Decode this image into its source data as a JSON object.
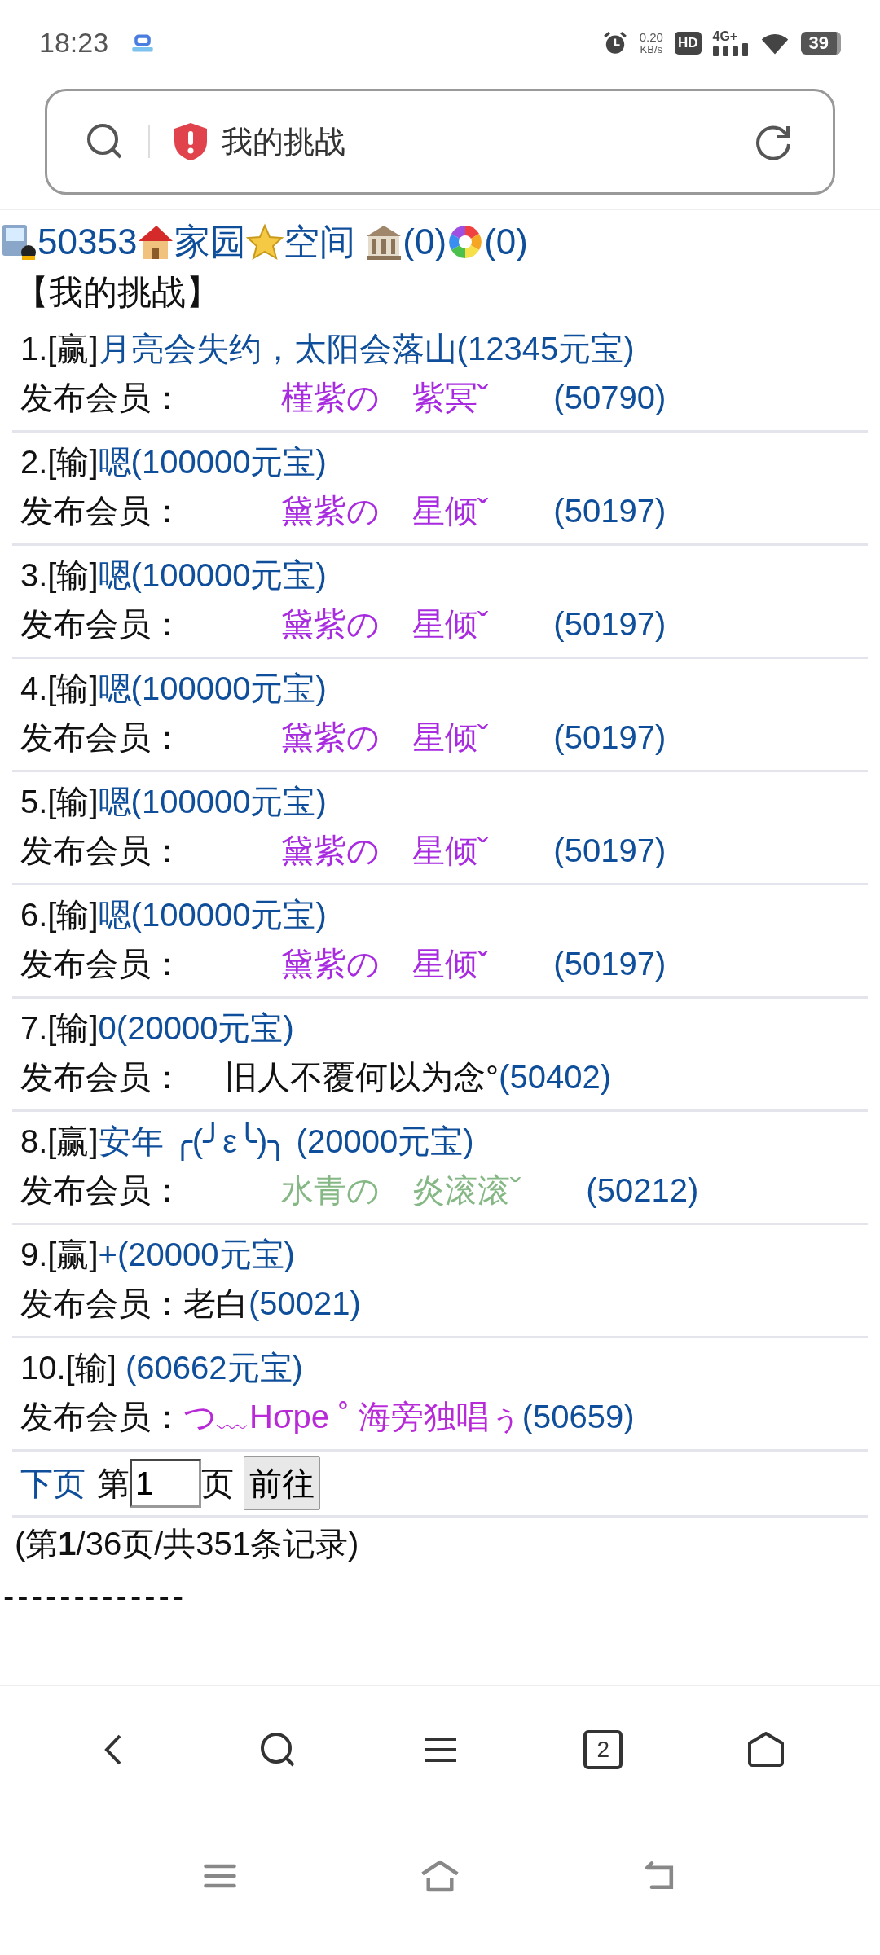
{
  "status_bar": {
    "time": "18:23",
    "net_speed": "0.20",
    "net_unit": "KB/s",
    "hd": "HD",
    "network": "4G+",
    "battery": "39"
  },
  "address_bar": {
    "title": "我的挑战"
  },
  "nav": {
    "user_id": "50353",
    "home": "家园",
    "space": "空间",
    "count_1": "(0)",
    "count_2": "(0)"
  },
  "heading": "【我的挑战】",
  "challenges": [
    {
      "index": "1.",
      "result": "[赢]",
      "title": "月亮会失约，太阳会落山(12345元宝)",
      "label": "发布会员：",
      "member": "　　　槿紫の　紫冥ˇ　　",
      "color": "#a82be0",
      "member_id": "(50790)"
    },
    {
      "index": "2.",
      "result": "[输]",
      "title": "嗯(100000元宝)",
      "label": "发布会员：",
      "member": "　　　黛紫の　星倾ˇ　　",
      "color": "#a82be0",
      "member_id": "(50197)"
    },
    {
      "index": "3.",
      "result": "[输]",
      "title": "嗯(100000元宝)",
      "label": "发布会员：",
      "member": "　　　黛紫の　星倾ˇ　　",
      "color": "#a82be0",
      "member_id": "(50197)"
    },
    {
      "index": "4.",
      "result": "[输]",
      "title": "嗯(100000元宝)",
      "label": "发布会员：",
      "member": "　　　黛紫の　星倾ˇ　　",
      "color": "#a82be0",
      "member_id": "(50197)"
    },
    {
      "index": "5.",
      "result": "[输]",
      "title": "嗯(100000元宝)",
      "label": "发布会员：",
      "member": "　　　黛紫の　星倾ˇ　　",
      "color": "#a82be0",
      "member_id": "(50197)"
    },
    {
      "index": "6.",
      "result": "[输]",
      "title": "嗯(100000元宝)",
      "label": "发布会员：",
      "member": "　　　黛紫の　星倾ˇ　　",
      "color": "#a82be0",
      "member_id": "(50197)"
    },
    {
      "index": "7.",
      "result": "[输]",
      "title": "0(20000元宝)",
      "label": "发布会员：",
      "member": "　 旧人不覆何以为念°",
      "color": "#111111",
      "member_id": "(50402)"
    },
    {
      "index": "8.",
      "result": "[赢]",
      "title": "安年 ╭(╯ε╰)╮ (20000元宝)",
      "label": "发布会员：",
      "member": "　　　水青の　炎滚滚ˇ　　",
      "color": "#86b886",
      "member_id": "(50212)"
    },
    {
      "index": "9.",
      "result": "[赢]",
      "title": "+(20000元宝)",
      "label": "发布会员：",
      "member": "老白",
      "color": "#111111",
      "member_id": "(50021)"
    },
    {
      "index": "10.",
      "result": "[输]",
      "title": " (60662元宝)",
      "label": "发布会员：",
      "member": "つ﹏Hσpe ˚ 海旁独唱ぅ",
      "color": "#b82ad8",
      "member_id": "(50659)"
    }
  ],
  "pager": {
    "next": "下页",
    "prefix": "第",
    "page_value": "1",
    "suffix": "页",
    "go": "前往"
  },
  "summary": "(第**1**/36页/共351条记录)",
  "divider_text": "-------------",
  "browser_toolbar": {
    "tab_count": "2"
  }
}
